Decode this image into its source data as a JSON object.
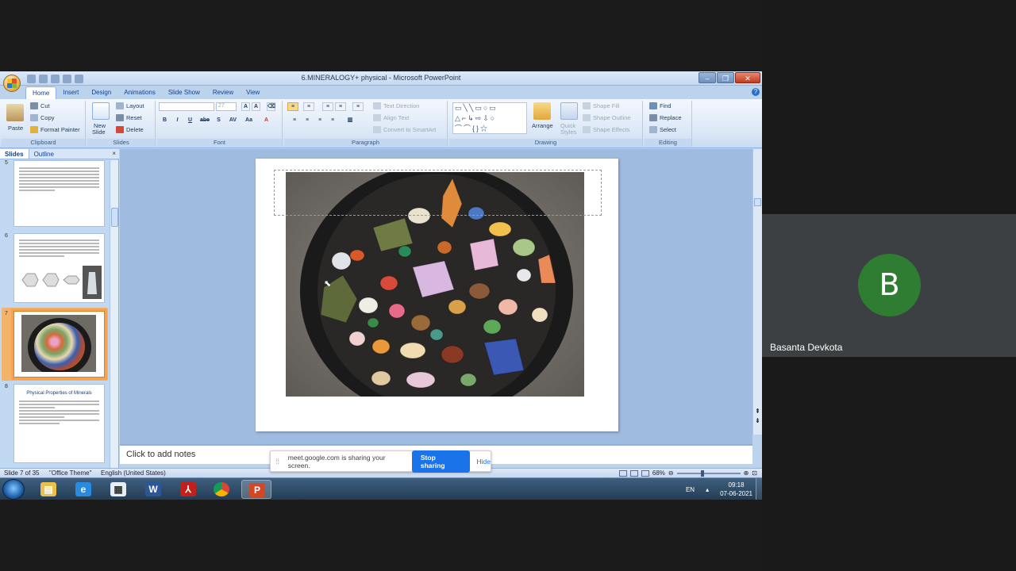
{
  "window": {
    "title": "6.MINERALOGY+ physical - Microsoft PowerPoint",
    "controls": {
      "minimize": "‒",
      "restore": "❐",
      "close": "✕"
    }
  },
  "ribbon": {
    "tabs": [
      "Home",
      "Insert",
      "Design",
      "Animations",
      "Slide Show",
      "Review",
      "View"
    ],
    "clipboard": {
      "paste": "Paste",
      "cut": "Cut",
      "copy": "Copy",
      "format_painter": "Format Painter",
      "label": "Clipboard"
    },
    "slides": {
      "new_slide": "New",
      "new_slide_2": "Slide",
      "layout": "Layout",
      "reset": "Reset",
      "delete": "Delete",
      "label": "Slides"
    },
    "font": {
      "size": "27",
      "label": "Font",
      "bold": "B",
      "italic": "I",
      "underline": "U",
      "strike": "abe",
      "shadow": "S"
    },
    "paragraph": {
      "text_direction": "Text Direction",
      "align_text": "Align Text",
      "smartart": "Convert to SmartArt",
      "label": "Paragraph"
    },
    "drawing": {
      "arrange": "Arrange",
      "quick_styles": "Quick",
      "quick_styles_2": "Styles",
      "shape_fill": "Shape Fill",
      "shape_outline": "Shape Outline",
      "shape_effects": "Shape Effects",
      "label": "Drawing"
    },
    "editing": {
      "find": "Find",
      "replace": "Replace",
      "select": "Select",
      "label": "Editing"
    }
  },
  "left_pane": {
    "tabs": [
      "Slides",
      "Outline"
    ],
    "close": "×",
    "thumbnails": [
      {
        "num": "5"
      },
      {
        "num": "6"
      },
      {
        "num": "7"
      },
      {
        "num": "8",
        "title": "Physical Properties of Minerals"
      }
    ]
  },
  "notes": {
    "placeholder": "Click to add notes"
  },
  "status": {
    "slide": "Slide 7 of 35",
    "theme": "\"Office Theme\"",
    "language": "English (United States)",
    "zoom": "68%"
  },
  "taskbar": {
    "lang": "EN",
    "time": "09:18",
    "date": "07-06-2021",
    "apps": [
      "explorer-icon",
      "ie-icon",
      "media-icon",
      "word-icon",
      "acrobat-icon",
      "chrome-icon",
      "powerpoint-icon"
    ]
  },
  "meet": {
    "message": "meet.google.com is sharing your screen.",
    "stop": "Stop sharing",
    "hide": "Hide"
  },
  "participant": {
    "initial": "B",
    "name": "Basanta Devkota",
    "avatar_color": "#2e7d32"
  }
}
